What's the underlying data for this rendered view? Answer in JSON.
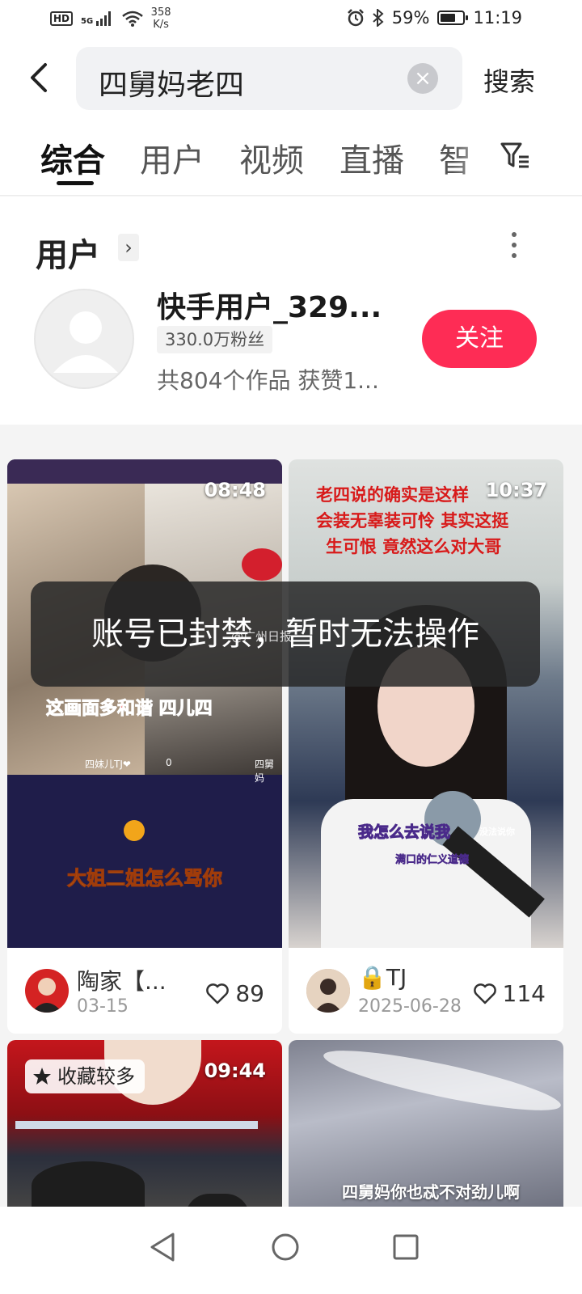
{
  "status_bar": {
    "network": "HD",
    "signal": "5G",
    "speed_value": "358",
    "speed_unit": "K/s",
    "battery": "59%",
    "time": "11:19",
    "icons": [
      "hd-icon",
      "signal-icon",
      "wifi-icon",
      "alarm-icon",
      "bluetooth-icon",
      "battery-icon"
    ]
  },
  "search": {
    "query": "四舅妈老四",
    "clear_icon": "×",
    "button_label": "搜索"
  },
  "tabs": [
    {
      "label": "综合",
      "active": true
    },
    {
      "label": "用户"
    },
    {
      "label": "视频"
    },
    {
      "label": "直播"
    },
    {
      "label": "智"
    }
  ],
  "user_section": {
    "title": "用户",
    "chevron": "›",
    "user": {
      "name": "快手用户_329...",
      "fans": "330.0万粉丝",
      "works": "共804个作品 获赞1...",
      "follow_label": "关注"
    }
  },
  "videos": [
    {
      "duration": "08:48",
      "overlay_top": "",
      "caption_1": "这画面多和谐 四儿四",
      "caption_2": "大姐二姐怎么骂你",
      "small_labels": [
        "四妹儿TJ❤",
        "0",
        "四舅妈"
      ],
      "author": "陶家【...",
      "date": "03-15",
      "likes": "89"
    },
    {
      "duration": "10:37",
      "overlay_lines": [
        "老四说的确实是这样 ",
        "会装无辜装可怜 其实这挺",
        "生可恨 竟然这么对大哥"
      ],
      "caption_1": "我怎么去说我",
      "caption_small": "没法说你",
      "caption_2": "满口的仁义道德",
      "author": "🔒TJ",
      "date": "2025-06-28",
      "likes": "114"
    },
    {
      "duration": "09:44",
      "badge": "收藏较多"
    },
    {
      "caption": "四舅妈你也忒不对劲儿啊"
    }
  ],
  "toast": {
    "message": "账号已封禁，暂时无法操作",
    "watermark": "@广州日报"
  },
  "colors": {
    "accent": "#fe2c55",
    "text_primary": "#222222",
    "text_secondary": "#999999",
    "background": "#f4f4f4"
  }
}
